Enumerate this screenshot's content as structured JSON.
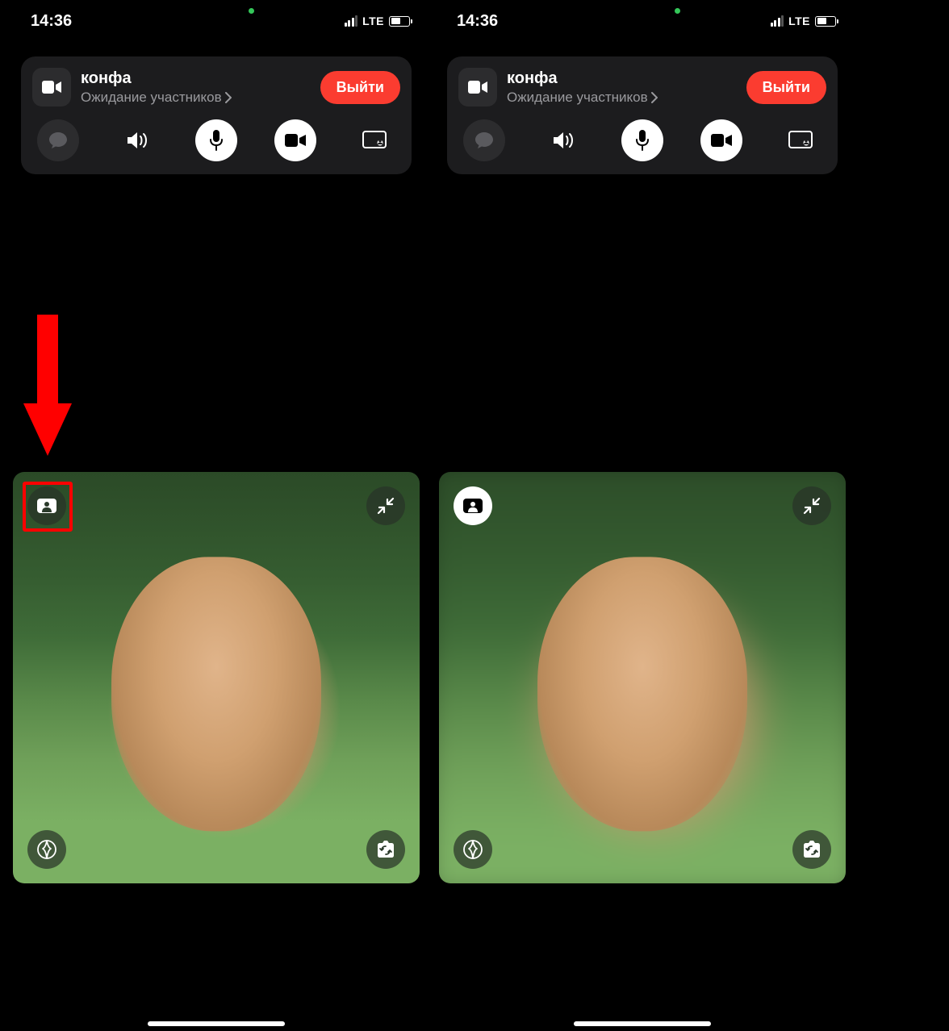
{
  "status": {
    "time": "14:36",
    "network": "LTE"
  },
  "call": {
    "title": "конфа",
    "subtitle": "Ожидание участников",
    "leave_label": "Выйти"
  },
  "portrait_badge": {
    "inactive_state": "dark",
    "active_state": "white"
  }
}
